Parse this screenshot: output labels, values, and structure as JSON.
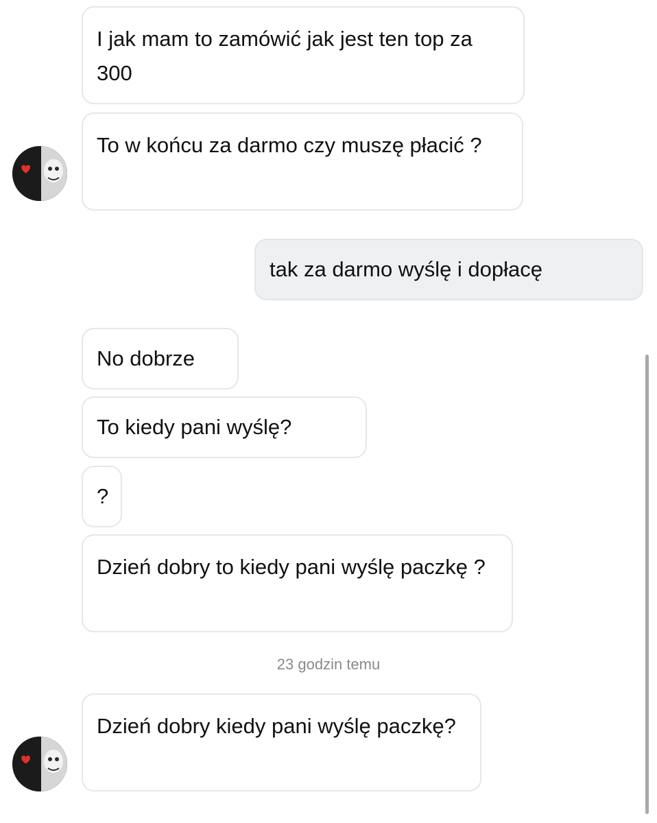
{
  "messages": [
    {
      "side": "received",
      "text": "I jak mam to zamówić jak jest ten top za 300"
    },
    {
      "side": "received",
      "text": "To w końcu za darmo czy muszę płacić ?"
    },
    {
      "side": "sent",
      "text": "tak za darmo wyślę i dopłacę"
    },
    {
      "side": "received",
      "text": "No dobrze"
    },
    {
      "side": "received",
      "text": "To kiedy pani wyślę?"
    },
    {
      "side": "received",
      "text": "?"
    },
    {
      "side": "received",
      "text": "Dzień dobry to kiedy pani wyślę paczkę ?"
    },
    {
      "side": "received",
      "text": "Dzień dobry kiedy pani wyślę paczkę?"
    }
  ],
  "timestamp": "23 godzin temu",
  "icons": {
    "avatar": "contact-avatar-icon"
  },
  "colors": {
    "received_bubble_bg": "#ffffff",
    "received_bubble_border": "#e7e7e7",
    "sent_bubble_bg": "#eef0f2",
    "timestamp_text": "#8a8a8a",
    "avatar_heart": "#e0312c"
  }
}
